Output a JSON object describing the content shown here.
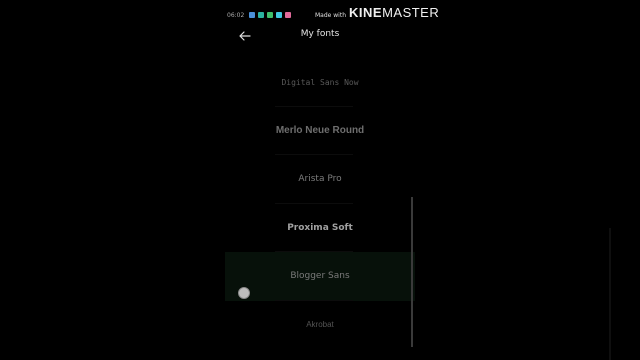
{
  "background_title": "My fonts",
  "status_bar": {
    "time": "06:02",
    "icons": [
      "notif-blue-icon",
      "notif-teal-icon",
      "notif-green-icon",
      "notif-cyan-icon",
      "notif-pink-icon"
    ],
    "icon_colors": [
      "#4a90d9",
      "#2bb3a0",
      "#3fbf6a",
      "#40c8e0",
      "#e06a9a"
    ]
  },
  "watermark": {
    "prefix": "Made with",
    "brand_bold": "KINE",
    "brand_light": "MASTER"
  },
  "header": {
    "back_icon": "arrow-left-icon",
    "title": "My fonts"
  },
  "fonts": [
    {
      "name": "Digital Sans Now"
    },
    {
      "name": "Merlo Neue Round"
    },
    {
      "name": "Arista Pro"
    },
    {
      "name": "Proxima Soft"
    },
    {
      "name": "Blogger Sans"
    },
    {
      "name": "Akrobat"
    }
  ],
  "colors": {
    "background": "#000000",
    "text": "#d9d9d9",
    "selected_row": "#07110a"
  }
}
